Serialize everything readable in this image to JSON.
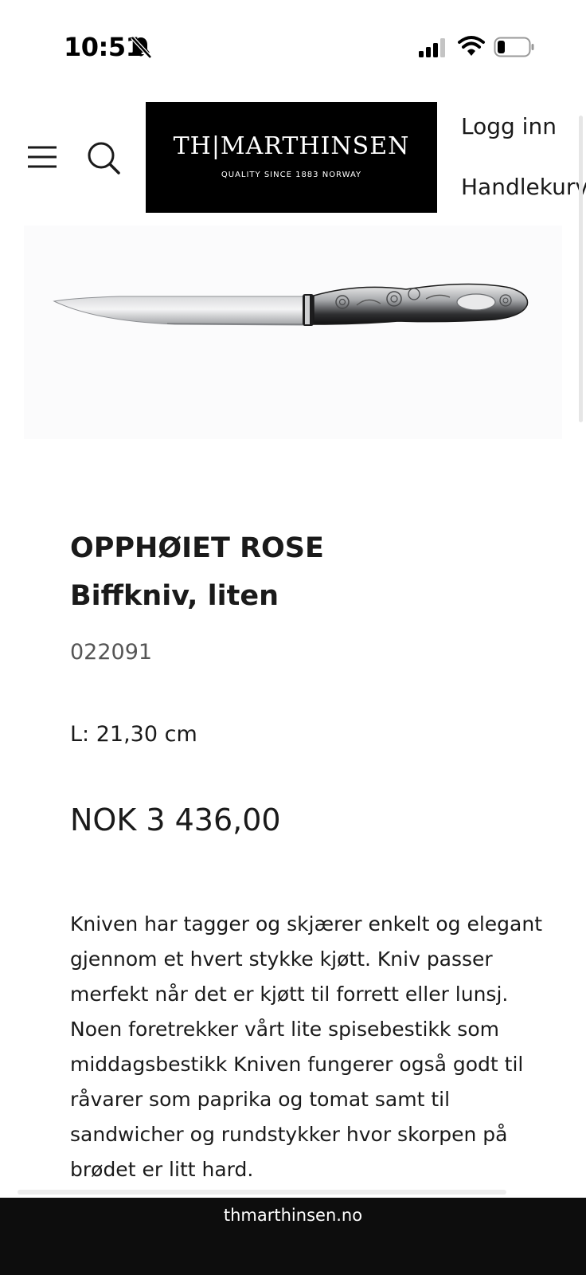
{
  "status_bar": {
    "time": "10:51",
    "icons": [
      "bell-slash-icon",
      "cellular-signal-icon",
      "wifi-icon",
      "battery-icon"
    ]
  },
  "header": {
    "menu_icon": "hamburger-menu-icon",
    "search_icon": "search-icon",
    "logo": {
      "name": "TH|MARTHINSEN",
      "tagline": "QUALITY SINCE 1883   NORWAY"
    },
    "login_label": "Logg inn",
    "cart_label": "Handlekurv ("
  },
  "product": {
    "image_alt": "knife-image",
    "collection": "OPPHØIET ROSE",
    "name": "Biffkniv, liten",
    "sku": "022091",
    "length": "L: 21,30 cm",
    "price": "NOK 3 436,00",
    "description": "Kniven har tagger og skjærer enkelt og elegant gjennom et hvert stykke kjøtt. Kniv passer merfekt når det er kjøtt til forrett eller lunsj. Noen foretrekker vårt lite spisebestikk som middagsbestikk Kniven fungerer også godt til råvarer som paprika og tomat samt til sandwicher og rundstykker hvor skorpen på brødet er litt hard."
  },
  "browser": {
    "url": "thmarthinsen.no"
  },
  "colors": {
    "logo_background": "#000000",
    "text": "#1a1a1a",
    "url_bar_background": "#0d0d0d"
  }
}
